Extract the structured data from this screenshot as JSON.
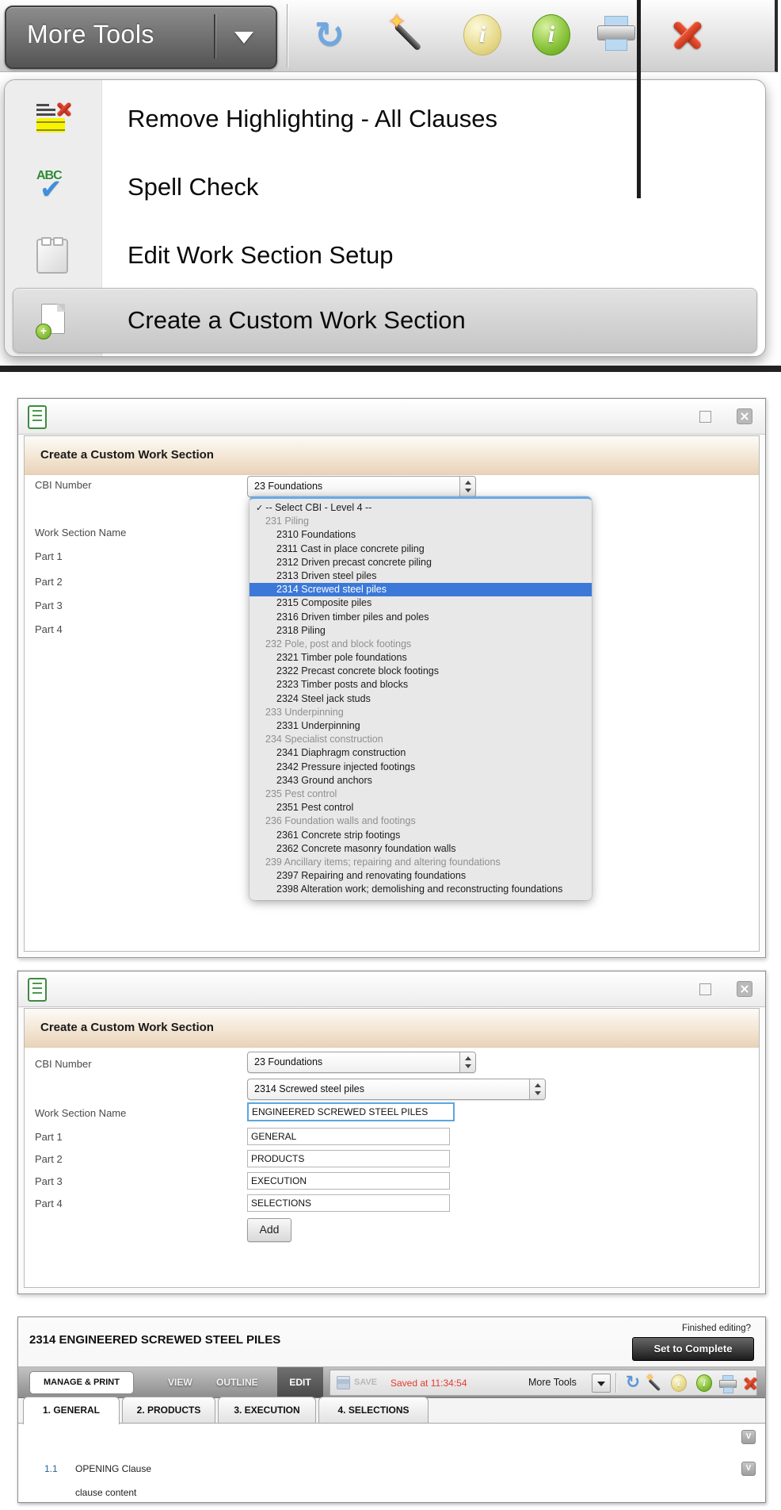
{
  "top_toolbar": {
    "more_tools_label": "More Tools",
    "icons": [
      "refresh-icon",
      "magic-wand-icon",
      "info-yellow-icon",
      "info-green-icon",
      "print-icon",
      "close-icon"
    ]
  },
  "tools_menu": {
    "items": [
      {
        "icon": "remove-highlighting-icon",
        "label": "Remove Highlighting - All Clauses"
      },
      {
        "icon": "spell-check-icon",
        "label": "Spell Check"
      },
      {
        "icon": "edit-work-section-setup-icon",
        "label": "Edit Work Section Setup"
      },
      {
        "icon": "create-custom-work-section-icon",
        "label": "Create a Custom Work Section",
        "highlighted": true
      }
    ]
  },
  "dialog_select": {
    "title": "Create a Custom Work Section",
    "labels": {
      "cbi_number": "CBI Number",
      "work_section_name": "Work Section Name",
      "part1": "Part 1",
      "part2": "Part 2",
      "part3": "Part 3",
      "part4": "Part 4"
    },
    "cbi_level2_value": "23 Foundations",
    "dropdown_options": [
      {
        "cls": "root",
        "label": "-- Select CBI - Level 4 --"
      },
      {
        "cls": "group",
        "label": "231 Piling"
      },
      {
        "cls": "leaf",
        "label": "2310 Foundations"
      },
      {
        "cls": "leaf",
        "label": "2311 Cast in place concrete piling"
      },
      {
        "cls": "leaf",
        "label": "2312 Driven precast concrete piling"
      },
      {
        "cls": "leaf",
        "label": "2313 Driven steel piles"
      },
      {
        "cls": "leaf selected",
        "label": "2314 Screwed steel piles"
      },
      {
        "cls": "leaf",
        "label": "2315 Composite piles"
      },
      {
        "cls": "leaf",
        "label": "2316 Driven timber piles and poles"
      },
      {
        "cls": "leaf",
        "label": "2318 Piling"
      },
      {
        "cls": "group",
        "label": "232 Pole, post and block footings"
      },
      {
        "cls": "leaf",
        "label": "2321 Timber pole foundations"
      },
      {
        "cls": "leaf",
        "label": "2322 Precast concrete block footings"
      },
      {
        "cls": "leaf",
        "label": "2323 Timber posts and blocks"
      },
      {
        "cls": "leaf",
        "label": "2324 Steel jack studs"
      },
      {
        "cls": "group",
        "label": "233 Underpinning"
      },
      {
        "cls": "leaf",
        "label": "2331 Underpinning"
      },
      {
        "cls": "group",
        "label": "234 Specialist construction"
      },
      {
        "cls": "leaf",
        "label": "2341 Diaphragm construction"
      },
      {
        "cls": "leaf",
        "label": "2342 Pressure injected footings"
      },
      {
        "cls": "leaf",
        "label": "2343 Ground anchors"
      },
      {
        "cls": "group",
        "label": "235 Pest control"
      },
      {
        "cls": "leaf",
        "label": "2351 Pest control"
      },
      {
        "cls": "group",
        "label": "236 Foundation walls and footings"
      },
      {
        "cls": "leaf",
        "label": "2361 Concrete strip footings"
      },
      {
        "cls": "leaf",
        "label": "2362 Concrete masonry foundation walls"
      },
      {
        "cls": "group",
        "label": "239 Ancillary items; repairing and altering foundations"
      },
      {
        "cls": "leaf",
        "label": "2397 Repairing and renovating foundations"
      },
      {
        "cls": "leaf",
        "label": "2398 Alteration work; demolishing and reconstructing foundations"
      }
    ]
  },
  "dialog_filled": {
    "title": "Create a Custom Work Section",
    "labels": {
      "cbi_number": "CBI Number",
      "work_section_name": "Work Section Name",
      "part1": "Part 1",
      "part2": "Part 2",
      "part3": "Part 3",
      "part4": "Part 4"
    },
    "cbi_level2_value": "23 Foundations",
    "cbi_level4_value": "2314 Screwed steel piles",
    "work_section_name_value": "ENGINEERED SCREWED STEEL PILES",
    "part1_value": "GENERAL",
    "part2_value": "PRODUCTS",
    "part3_value": "EXECUTION",
    "part4_value": "SELECTIONS",
    "add_button_label": "Add"
  },
  "editor": {
    "title": "2314 ENGINEERED SCREWED STEEL PILES",
    "finished_editing_label": "Finished editing?",
    "set_to_complete_label": "Set to Complete",
    "nav": {
      "manage_print": "MANAGE & PRINT",
      "view": "VIEW",
      "outline": "OUTLINE",
      "edit": "EDIT",
      "save": "SAVE",
      "saved_at": "Saved at 11:34:54",
      "more_tools": "More Tools"
    },
    "tabs": [
      "1. GENERAL",
      "2. PRODUCTS",
      "3. EXECUTION",
      "4. SELECTIONS"
    ],
    "clause": {
      "number": "1.1",
      "title": "OPENING Clause",
      "content": "clause content"
    },
    "collapse_glyph": "V"
  },
  "colors": {
    "selection_blue": "#3b78d8",
    "saved_red": "#e8392e",
    "focus_border_blue": "#5aa7e0",
    "header_beige": "#e9d3b8"
  }
}
